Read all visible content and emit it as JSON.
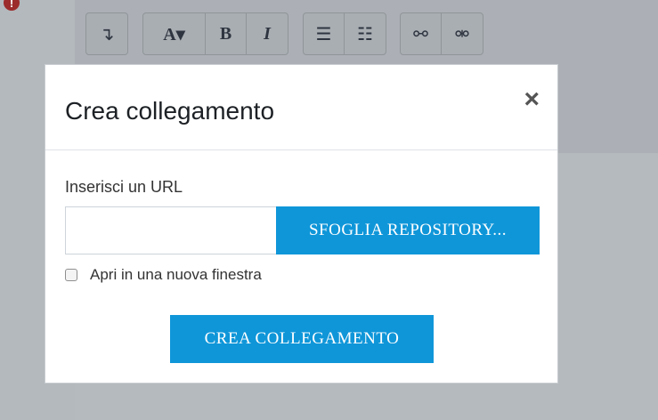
{
  "toolbar": {
    "group1": [
      {
        "icon": "insert-down-icon",
        "glyph": "↴"
      }
    ],
    "group2": [
      {
        "icon": "font-style-icon",
        "glyph": "A▾"
      },
      {
        "icon": "bold-icon",
        "glyph": "B"
      },
      {
        "icon": "italic-icon",
        "glyph": "I"
      }
    ],
    "group3": [
      {
        "icon": "unordered-list-icon",
        "glyph": "☰"
      },
      {
        "icon": "ordered-list-icon",
        "glyph": "☷"
      }
    ],
    "group4": [
      {
        "icon": "link-icon",
        "glyph": "⚯"
      },
      {
        "icon": "unlink-icon",
        "glyph": "⚮"
      }
    ]
  },
  "modal": {
    "title": "Crea collegamento",
    "close_glyph": "×",
    "url_label": "Inserisci un URL",
    "url_value": "",
    "browse_label": "SFOGLIA REPOSITORY...",
    "new_window_label": "Apri in una nuova finestra",
    "new_window_checked": false,
    "create_label": "CREA COLLEGAMENTO"
  },
  "colors": {
    "accent": "#0f96d9",
    "overlay": "#aeb4b8",
    "alert": "#9c2b2b"
  }
}
